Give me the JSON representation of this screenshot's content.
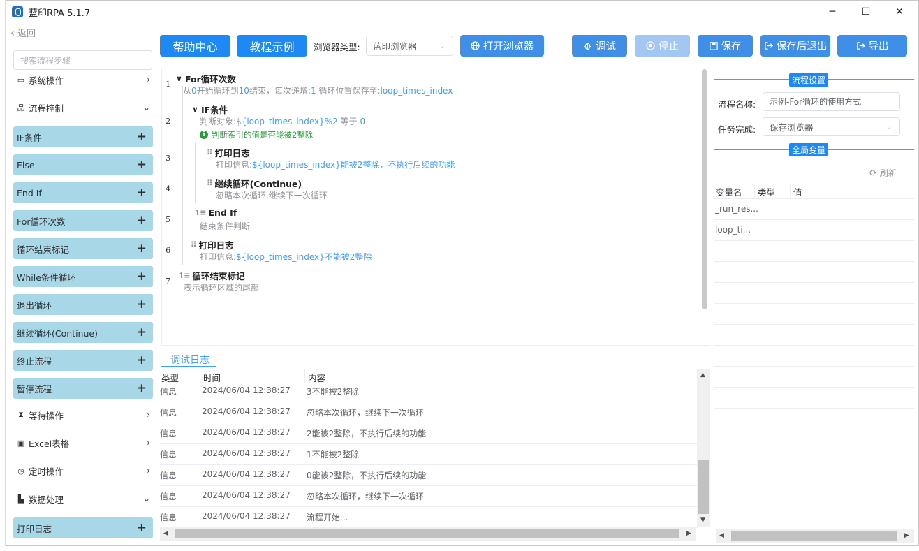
{
  "window": {
    "title": "蓝印RPA 5.1.7",
    "minimize": "─",
    "maximize": "☐",
    "close": "✕"
  },
  "nav": {
    "back": "返回",
    "search_placeholder": "搜索流程步骤"
  },
  "sidebar": [
    {
      "kind": "cat",
      "label": "系统操作",
      "icon": "window-icon",
      "glyph": "▭",
      "chev": "›"
    },
    {
      "kind": "cat",
      "label": "流程控制",
      "icon": "sitemap-icon",
      "glyph": "品",
      "chev": "⌄"
    },
    {
      "kind": "item",
      "label": "IF条件"
    },
    {
      "kind": "item",
      "label": "Else"
    },
    {
      "kind": "item",
      "label": "End If"
    },
    {
      "kind": "item",
      "label": "For循环次数"
    },
    {
      "kind": "item",
      "label": "循环结束标记"
    },
    {
      "kind": "item",
      "label": "While条件循环"
    },
    {
      "kind": "item",
      "label": "退出循环"
    },
    {
      "kind": "item",
      "label": "继续循环(Continue)"
    },
    {
      "kind": "item",
      "label": "终止流程"
    },
    {
      "kind": "item",
      "label": "暂停流程"
    },
    {
      "kind": "cat",
      "label": "等待操作",
      "icon": "hourglass-icon",
      "glyph": "⧗",
      "chev": "›"
    },
    {
      "kind": "cat",
      "label": "Excel表格",
      "icon": "excel-icon",
      "glyph": "▣",
      "chev": "›"
    },
    {
      "kind": "cat",
      "label": "定时操作",
      "icon": "clock-icon",
      "glyph": "◷",
      "chev": "›"
    },
    {
      "kind": "cat",
      "label": "数据处理",
      "icon": "chart-icon",
      "glyph": "▙",
      "chev": "⌄"
    },
    {
      "kind": "item",
      "label": "打印日志"
    }
  ],
  "toolbar": {
    "help": "帮助中心",
    "tutorial": "教程示例",
    "browser_type_label": "浏览器类型:",
    "browser_type_value": "蓝印浏览器",
    "open_browser": "打开浏览器",
    "debug": "调试",
    "stop": "停止",
    "save": "保存",
    "save_exit": "保存后退出",
    "export": "导出"
  },
  "flow": {
    "line_numbers": [
      "1",
      "2",
      "3",
      "4",
      "5",
      "6",
      "7"
    ],
    "for": {
      "title": "For循环次数",
      "d1": "从",
      "d2": "0",
      "d3": "开始循环到",
      "d4": "10",
      "d5": "结束，每次递增:",
      "d6": "1",
      "d7": " 循环位置保存至:",
      "d8": "loop_times_index"
    },
    "if": {
      "title": "IF条件",
      "d1": "判断对象:",
      "d2": "${loop_times_index}%2",
      "d3": " 等于 ",
      "d4": "0",
      "note": "判断索引的值是否能被2整除"
    },
    "print1": {
      "title": "打印日志",
      "d1": "打印信息:",
      "d2": "${loop_times_index}能被2整除，不执行后续的功能"
    },
    "cont": {
      "title": "继续循环(Continue)",
      "desc": "忽略本次循环,继续下一次循环"
    },
    "endif": {
      "title": "End If",
      "desc": "结束条件判断"
    },
    "print2": {
      "title": "打印日志",
      "d1": "打印信息:",
      "d2": "${loop_times_index}不能被2整除"
    },
    "loopend": {
      "title": "循环结束标记",
      "desc": "表示循环区域的尾部"
    }
  },
  "log": {
    "tab": "调试日志",
    "headers": [
      "类型",
      "时间",
      "内容"
    ],
    "rows": [
      [
        "信息",
        "2024/06/04 12:38:27",
        "3不能被2整除"
      ],
      [
        "信息",
        "2024/06/04 12:38:27",
        "忽略本次循环，继续下一次循环"
      ],
      [
        "信息",
        "2024/06/04 12:38:27",
        "2能被2整除，不执行后续的功能"
      ],
      [
        "信息",
        "2024/06/04 12:38:27",
        "1不能被2整除"
      ],
      [
        "信息",
        "2024/06/04 12:38:27",
        "0能被2整除，不执行后续的功能"
      ],
      [
        "信息",
        "2024/06/04 12:38:27",
        "忽略本次循环，继续下一次循环"
      ],
      [
        "信息",
        "2024/06/04 12:38:27",
        "流程开始..."
      ]
    ]
  },
  "settings": {
    "section_title": "流程设置",
    "name_label": "流程名称:",
    "name_value": "示例-For循环的使用方式",
    "complete_label": "任务完成:",
    "complete_value": "保存浏览器",
    "vars_title": "全局变量",
    "refresh": "刷新",
    "var_headers": [
      "变量名",
      "类型",
      "值"
    ],
    "vars": [
      "_run_res...",
      "loop_ti..."
    ]
  },
  "colors": {
    "primary": "#1e88f5",
    "sidebar_item": "#a8d8e8",
    "link": "#409eff",
    "note": "#2a9a3e"
  }
}
